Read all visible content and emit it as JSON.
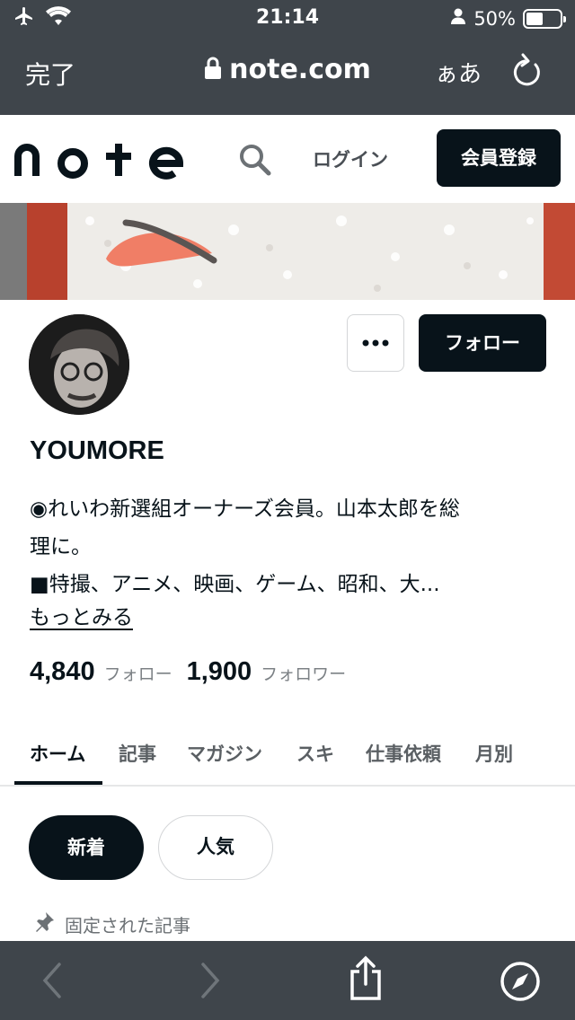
{
  "status_bar": {
    "time": "21:14",
    "battery": "50%",
    "battery_level": 0.5
  },
  "safari": {
    "done": "完了",
    "url": "note.com",
    "text_size": "ぁあ"
  },
  "header": {
    "logo": "note",
    "login": "ログイン",
    "register": "会員登録"
  },
  "profile": {
    "more_label": "•••",
    "follow": "フォロー",
    "name": "YOUMORE",
    "bio_line1": "◉れいわ新選組オーナーズ会員。山本太郎を総",
    "bio_line2": "理に。",
    "bio_line3": "■特撮、アニメ、映画、ゲーム、昭和、大...",
    "read_more": "もっとみる",
    "following_count": "4,840",
    "following_label": "フォロー",
    "followers_count": "1,900",
    "followers_label": "フォロワー"
  },
  "tabs": [
    {
      "label": "ホーム",
      "active": true
    },
    {
      "label": "記事"
    },
    {
      "label": "マガジン"
    },
    {
      "label": "スキ"
    },
    {
      "label": "仕事依頼"
    },
    {
      "label": "月別"
    }
  ],
  "filters": {
    "new": "新着",
    "popular": "人気"
  },
  "pinned": "固定された記事",
  "colors": {
    "dark": "#08131a",
    "chrome": "#3f454b"
  }
}
